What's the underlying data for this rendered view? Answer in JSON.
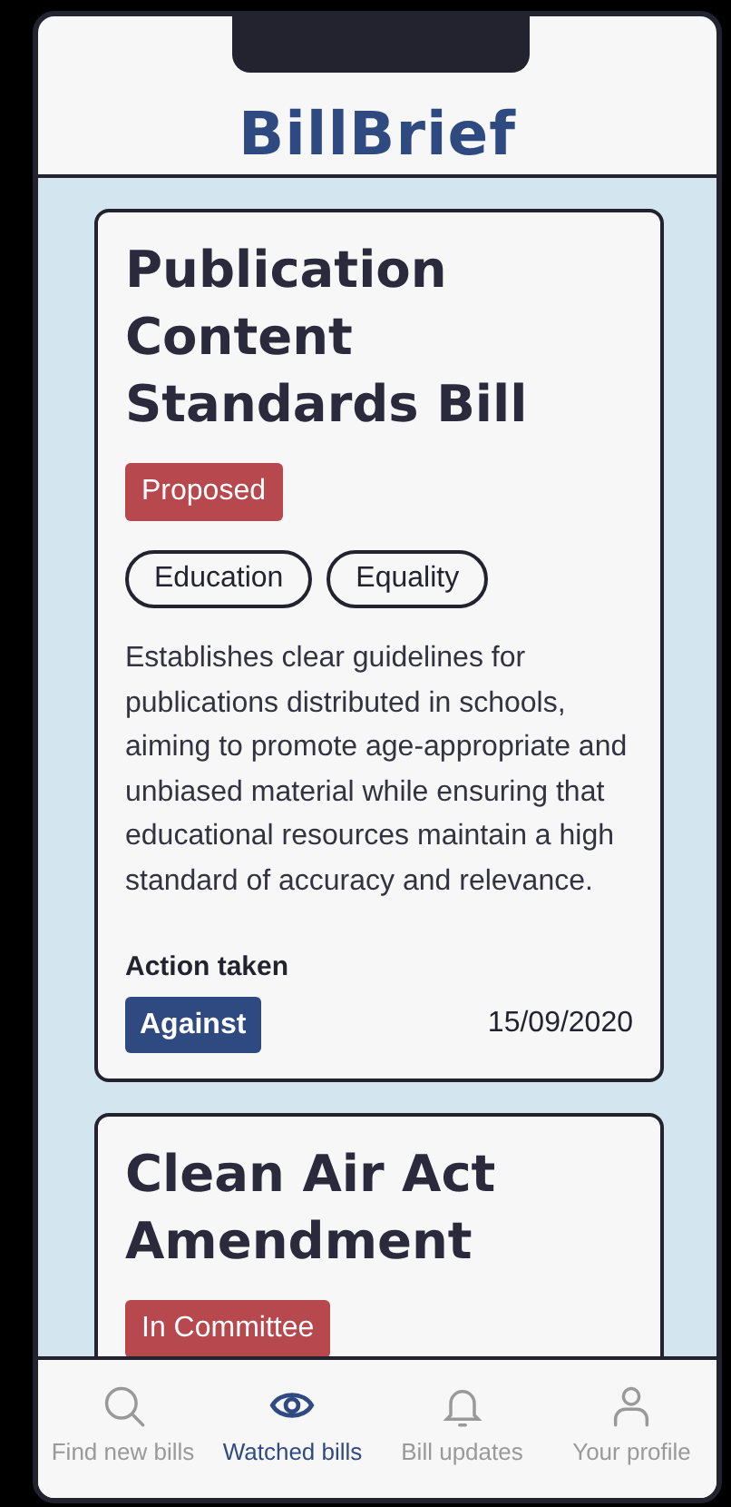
{
  "app_title": "BillBrief",
  "bills": [
    {
      "title": "Publication Content Standards Bill",
      "status": "Proposed",
      "tags": [
        "Education",
        "Equality"
      ],
      "description": "Establishes clear guidelines for publications distributed in schools, aiming to promote age-appropriate and unbiased material while ensuring that educational resources maintain a high standard of accuracy and relevance.",
      "action_heading": "Action taken",
      "action": "Against",
      "date": "15/09/2020"
    },
    {
      "title": "Clean Air Act Amendment",
      "status": "In Committee"
    }
  ],
  "nav": [
    {
      "kind": "search",
      "label": "Find new bills",
      "selected": false
    },
    {
      "kind": "eye",
      "label": "Watched bills",
      "selected": true
    },
    {
      "kind": "bell",
      "label": "Bill updates",
      "selected": false
    },
    {
      "kind": "person",
      "label": "Your profile",
      "selected": false
    }
  ]
}
